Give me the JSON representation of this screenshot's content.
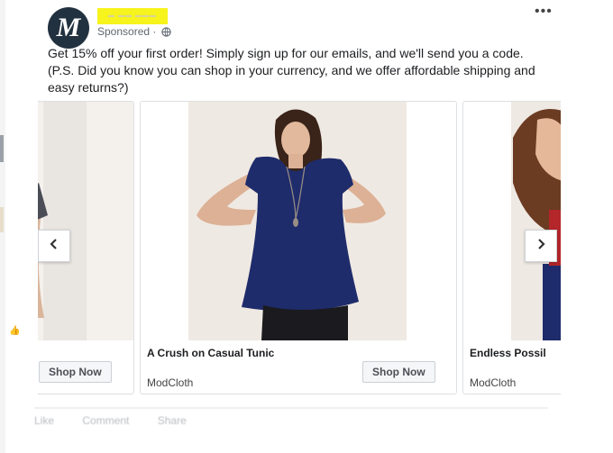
{
  "post": {
    "sponsored_label": "Sponsored ·",
    "more_label": "•••",
    "text": "Get 15% off your first order! Simply sign up for our emails, and we'll send you a code. (P.S. Did you know you can shop in your currency, and we offer affordable shipping and easy returns?)"
  },
  "carousel": {
    "cards": [
      {
        "headline": "",
        "brand": "",
        "cta": "Shop Now"
      },
      {
        "headline": "A Crush on Casual Tunic",
        "brand": "ModCloth",
        "cta": "Shop Now"
      },
      {
        "headline": "Endless Possil",
        "brand": "ModCloth",
        "cta": ""
      }
    ]
  },
  "actions": {
    "like": "Like",
    "comment": "Comment",
    "share": "Share"
  },
  "colors": {
    "highlight": "#f7f31d",
    "tunic": "#1f2c6b",
    "avatar_bg": "#22313f"
  },
  "icons": {
    "avatar": "M"
  }
}
